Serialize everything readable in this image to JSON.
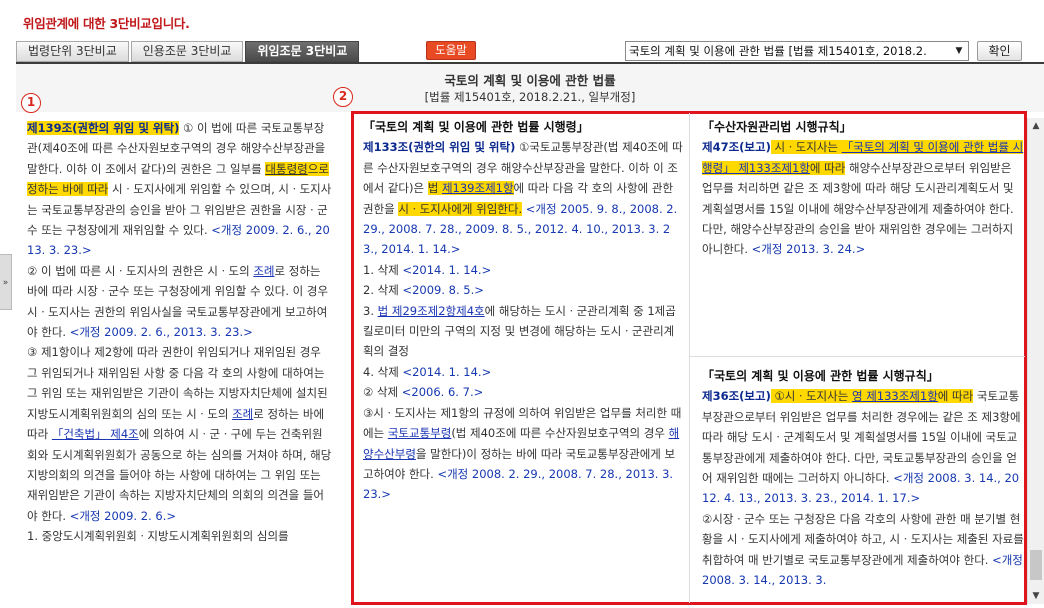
{
  "notice": "위임관계에 대한 3단비교입니다.",
  "tabs": [
    {
      "label": "법령단위 3단비교",
      "active": false
    },
    {
      "label": "인용조문 3단비교",
      "active": false
    },
    {
      "label": "위임조문 3단비교",
      "active": true
    }
  ],
  "help_label": "도움말",
  "law_select": "국토의 계획 및 이용에 관한 법률 [법률 제15401호, 2018.2.",
  "confirm_label": "확인",
  "law_title": "국토의 계획 및 이용에 관한 법률",
  "law_sub": "[법률 제15401호, 2018.2.21., 일부개정]",
  "markers": {
    "left": "1",
    "right": "2"
  },
  "col1": {
    "p1_title": "제139조(권한의 위임 및 위탁)",
    "p1_a": " ① 이 법에 따른 국토교통부장관(제40조에 따른 수산자원보호구역의 경우 해양수산부장관을 말한다. 이하 이 조에서 같다)의 권한은 그 일부를 ",
    "p1_link": "대통령령",
    "p1_b": "으로 정하는 바에 따라",
    "p1_c": " 시ㆍ도지사에게 위임할 수 있으며, 시ㆍ도지사는 국토교통부장관의 승인을 받아 그 위임받은 권한을 시장ㆍ군수 또는 구청장에게 재위임할 수 있다.",
    "p1_rev": " <개정 2009. 2. 6., 2013. 3. 23.>",
    "p2_a": "② 이 법에 따른 시ㆍ도지사의 권한은 시ㆍ도의 ",
    "p2_link": "조례",
    "p2_b": "로 정하는 바에 따라 시장ㆍ군수 또는 구청장에게 위임할 수 있다. 이 경우 시ㆍ도지사는 권한의 위임사실을 국토교통부장관에게 보고하여야 한다.",
    "p2_rev": " <개정 2009. 2. 6., 2013. 3. 23.>",
    "p3_a": "③ 제1항이나 제2항에 따라 권한이 위임되거나 재위임된 경우 그 위임되거나 재위임된 사항 중 다음 각 호의 사항에 대하여는 그 위임 또는 재위임받은 기관이 속하는 지방자치단체에 설치된 지방도시계획위원회의 심의 또는 시ㆍ도의 ",
    "p3_link1": "조례",
    "p3_b": "로 정하는 바에 따라 ",
    "p3_link2": "「건축법」",
    "p3_link3": " 제4조",
    "p3_c": "에 의하여 시ㆍ군ㆍ구에 두는 건축위원회와 도시계획위원회가 공동으로 하는 심의를 거쳐야 하며, 해당 지방의회의 의견을 들어야 하는 사항에 대하여는 그 위임 또는 재위임받은 기관이 속하는 지방자치단체의 의회의 의견을 들어야 한다.",
    "p3_rev": " <개정 2009. 2. 6.>",
    "p4": "1. 중앙도시계획위원회ㆍ지방도시계획위원회의 심의를"
  },
  "col2": {
    "heading": "「국토의 계획 및 이용에 관한 법률 시행령」",
    "title": "제133조(권한의 위임 및 위탁)",
    "a": " ①국토교통부장관(법 제40조에 따른 수산자원보호구역의 경우 해양수산부장관을 말한다. 이하 이 조에서 같다)은 ",
    "hl1": "법 ",
    "link1": "제139조제1항",
    "b": "에 따라 다음 각 호의 사항에 관한 권한을 ",
    "hl2": "시ㆍ도지사에게 위임한다.",
    "rev": " <개정 2005. 9. 8., 2008. 2. 29., 2008. 7. 28., 2009. 8. 5., 2012. 4. 10., 2013. 3. 23., 2014. 1. 14.>",
    "i1": "1. 삭제",
    "i1_rev": " <2014. 1. 14.>",
    "i2": "2. 삭제",
    "i2_rev": " <2009. 8. 5.>",
    "i3_a": "3. ",
    "i3_link": "법 제29조제2항제4호",
    "i3_b": "에 해당하는 도시ㆍ군관리계획 중 1제곱킬로미터 미만의 구역의 지정 및 변경에 해당하는 도시ㆍ군관리계획의 결정",
    "i4": "4. 삭제",
    "i4_rev": " <2014. 1. 14.>",
    "i5": "② 삭제",
    "i5_rev": " <2006. 6. 7.>",
    "p3_a": "③시ㆍ도지사는 제1항의 규정에 의하여 위임받은 업무를 처리한 때에는 ",
    "p3_link1": "국토교통부령",
    "p3_b": "(법 제40조에 따른 수산자원보호구역의 경우 ",
    "p3_link2": "해양수산부령",
    "p3_c": "을 말한다)이 정하는 바에 따라 국토교통부장관에게 보고하여야 한다.",
    "p3_rev": " <개정 2008. 2. 29., 2008. 7. 28., 2013. 3. 23.>"
  },
  "col3": {
    "heading": "「수산자원관리법 시행규칙」",
    "title": "제47조(보고)",
    "hl_a": " 시ㆍ도지사는 ",
    "hl_link": "「국토의 계획 및 이용에 관한 법률 시행령」",
    "hl_link2": " 제133조제1항",
    "hl_b": "에 따라",
    "a": " 해양수산부장관으로부터 위임받은 업무를 처리하면 같은 조 제3항에 따라 해당 도시관리계획도서 및 계획설명서를 15일 이내에 해양수산부장관에게 제출하여야 한다. 다만, 해양수산부장관의 승인을 받아 재위임한 경우에는 그러하지 아니한다.",
    "rev": " <개정 2013. 3. 24.>"
  },
  "col4": {
    "heading": "「국토의 계획 및 이용에 관한 법률 시행규칙」",
    "title": "제36조(보고)",
    "hl_a": " ①시ㆍ도지사는 ",
    "hl_link1": "영",
    "hl_link2": " 제133조제1항",
    "hl_b": "에 따라",
    "a": " 국토교통부장관으로부터 위임받은 업무를 처리한 경우에는 같은 조 제3항에 따라 해당 도시ㆍ군계획도서 및 계획설명서를 15일 이내에 국토교통부장관에게 제출하여야 한다. 다만, 국토교통부장관의 승인을 얻어 재위임한 때에는 그러하지 아니하다.",
    "rev": " <개정 2008. 3. 14., 2012. 4. 13., 2013. 3. 23., 2014. 1. 17.>",
    "p2": "②시장ㆍ군수 또는 구청장은 다음 각호의 사항에 관한 매 분기별 현황을 시ㆍ도지사에게 제출하여야 하고, 시ㆍ도지사는 제출된 자료를 취합하여 매 반기별로 국토교통부장관에게 제출하여야 한다.",
    "p2_rev": " <개정 2008. 3. 14., 2013. 3."
  }
}
